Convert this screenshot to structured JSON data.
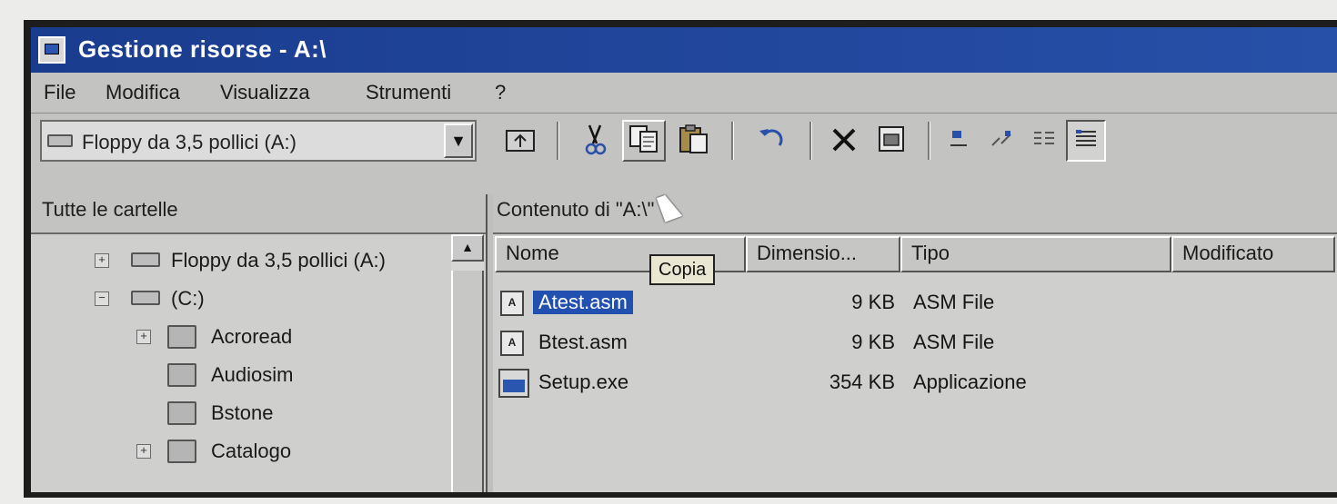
{
  "window": {
    "title": "Gestione risorse - A:\\"
  },
  "menu": [
    "File",
    "Modifica",
    "Visualizza",
    "Strumenti",
    "?"
  ],
  "address": {
    "value": "Floppy da 3,5 pollici (A:)"
  },
  "toolbar": {
    "buttons": [
      "up-folder",
      "cut",
      "copy",
      "paste",
      "undo",
      "delete",
      "properties",
      "large-icons",
      "small-icons",
      "list",
      "details"
    ],
    "tooltip": "Copia"
  },
  "left_pane": {
    "header": "Tutte le cartelle",
    "tree": [
      {
        "label": "Floppy da 3,5 pollici (A:)",
        "expander": "+"
      },
      {
        "label": "(C:)",
        "expander": "−"
      },
      {
        "label": "Acroread",
        "expander": "+"
      },
      {
        "label": "Audiosim",
        "expander": ""
      },
      {
        "label": "Bstone",
        "expander": ""
      },
      {
        "label": "Catalogo",
        "expander": "+"
      }
    ]
  },
  "right_pane": {
    "header": "Contenuto di \"A:\\\"",
    "columns": [
      "Nome",
      "Dimensio...",
      "Tipo",
      "Modificato"
    ],
    "files": [
      {
        "name": "Atest.asm",
        "size": "9 KB",
        "type": "ASM File",
        "selected": true
      },
      {
        "name": "Btest.asm",
        "size": "9 KB",
        "type": "ASM File",
        "selected": false
      },
      {
        "name": "Setup.exe",
        "size": "354 KB",
        "type": "Applicazione",
        "selected": false
      }
    ]
  },
  "colors": {
    "titlebar": "#1a3c8e",
    "selection": "#2250b0",
    "tooltip_bg": "#e9e7d2"
  }
}
